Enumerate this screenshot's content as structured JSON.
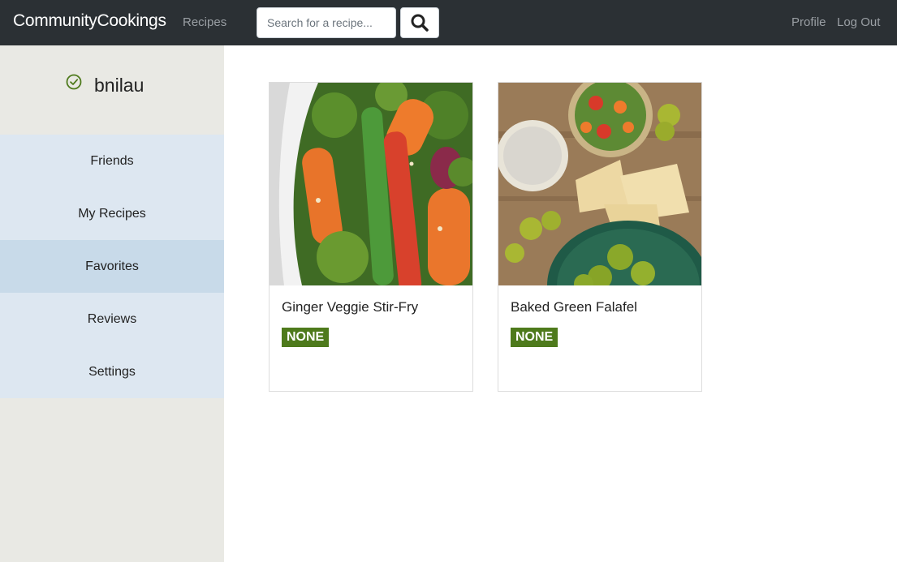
{
  "navbar": {
    "brand": "CommunityCookings",
    "recipes_link": "Recipes",
    "search_placeholder": "Search for a recipe...",
    "search_icon": "search-icon",
    "profile_link": "Profile",
    "logout_link": "Log Out"
  },
  "sidebar": {
    "username": "bnilau",
    "verified_icon": "check-circle-icon",
    "items": [
      {
        "label": "Friends",
        "active": false
      },
      {
        "label": "My Recipes",
        "active": false
      },
      {
        "label": "Favorites",
        "active": true
      },
      {
        "label": "Reviews",
        "active": false
      },
      {
        "label": "Settings",
        "active": false
      }
    ]
  },
  "recipes": [
    {
      "title": "Ginger Veggie Stir-Fry",
      "badge": "NONE"
    },
    {
      "title": "Baked Green Falafel",
      "badge": "NONE"
    }
  ],
  "colors": {
    "navbar_bg": "#2b3034",
    "sidebar_bg": "#e9e9e4",
    "menu_bg": "#dde7f1",
    "menu_active_bg": "#c8dae9",
    "badge_bg": "#4e7a1c",
    "check_icon": "#4e7a1c"
  }
}
